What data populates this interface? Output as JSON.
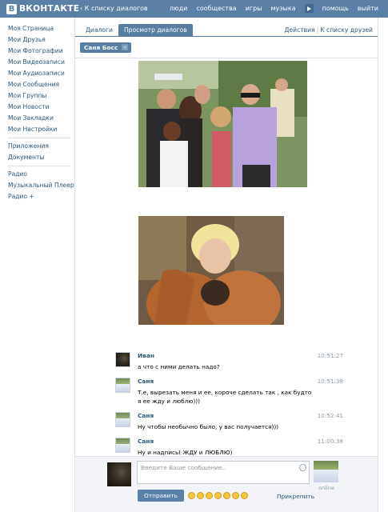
{
  "header": {
    "logo_letter": "B",
    "logo_text": "ВКОНТАКТЕ",
    "back_link": "К списку диалогов",
    "nav": [
      "люди",
      "сообщества",
      "игры",
      "музыка"
    ],
    "nav_after_play": [
      "помощь",
      "выйти"
    ]
  },
  "sidebar": {
    "group1": [
      "Моя Страница",
      "Мои Друзья",
      "Мои Фотографии",
      "Мои Видеозаписи",
      "Мои Аудиозаписи",
      "Мои Сообщения",
      "Мои Группы",
      "Мои Новости",
      "Мои Закладки",
      "Мои Настройки"
    ],
    "group2": [
      "Приложения",
      "Документы"
    ],
    "group3": [
      "Радио",
      "Музыкальный Плеер",
      "Радио +"
    ]
  },
  "tabs": {
    "dialogs": "Диалоги",
    "view": "Просмотр диалогов"
  },
  "actions": {
    "actions_label": "Действия",
    "friends_list": "К списку друзей"
  },
  "chip": {
    "name": "Саня Босс",
    "close": "×"
  },
  "messages": [
    {
      "name": "Иван",
      "time": "10:51:27",
      "text": "а что с ними делать надо?",
      "avatar": "dark"
    },
    {
      "name": "Саня",
      "time": "10:51:38",
      "text": "Т.е, вырезать меня и ее, короче сделать так , как будто я ее жду и люблю)))",
      "avatar": "man"
    },
    {
      "name": "Саня",
      "time": "10:52:41",
      "text": "Ну чтобы необычно было, у вас получается)))",
      "avatar": "man"
    },
    {
      "name": "Саня",
      "time": "11:00:38",
      "text": "Ну и надпись( ЖДУ и ЛЮБЛЮ)",
      "avatar": "man"
    }
  ],
  "compose": {
    "placeholder": "Введите Ваше сообщение..",
    "send_label": "Отправить",
    "attach_label": "Прикрепить",
    "online_label": "online"
  },
  "colors": {
    "brand": "#5b7fa6",
    "link": "#2b587a"
  }
}
